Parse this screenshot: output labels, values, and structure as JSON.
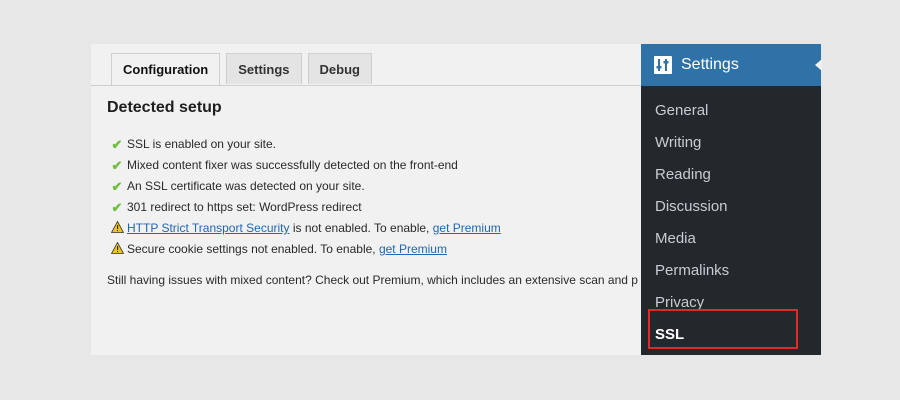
{
  "tabs": [
    {
      "label": "Configuration",
      "active": true
    },
    {
      "label": "Settings",
      "active": false
    },
    {
      "label": "Debug",
      "active": false
    }
  ],
  "heading": "Detected setup",
  "checks": [
    {
      "icon": "check-icon",
      "text": "SSL is enabled on your site."
    },
    {
      "icon": "check-icon",
      "text": "Mixed content fixer was successfully detected on the front-end"
    },
    {
      "icon": "check-icon",
      "text": "An SSL certificate was detected on your site."
    },
    {
      "icon": "check-icon",
      "text": "301 redirect to https set: WordPress redirect"
    }
  ],
  "warnings": [
    {
      "icon": "warning-icon",
      "link": "HTTP Strict Transport Security",
      "text": " is not enabled. To enable, ",
      "cta": "get Premium"
    },
    {
      "icon": "warning-icon",
      "text": "Secure cookie settings not enabled. To enable, ",
      "cta": "get Premium"
    }
  ],
  "note": "Still having issues with mixed content? Check out Premium, which includes an extensive scan and p",
  "sidebar": {
    "title": "Settings",
    "icon": "settings-sliders-icon",
    "items": [
      "General",
      "Writing",
      "Reading",
      "Discussion",
      "Media",
      "Permalinks",
      "Privacy",
      "SSL"
    ],
    "current": "SSL"
  },
  "colors": {
    "sidebar_bg": "#23282d",
    "sidebar_header": "#2f72a8",
    "check": "#6fbf3b",
    "warning": "#f0c419",
    "link": "#1f66b5",
    "highlight": "#e02a2a"
  }
}
